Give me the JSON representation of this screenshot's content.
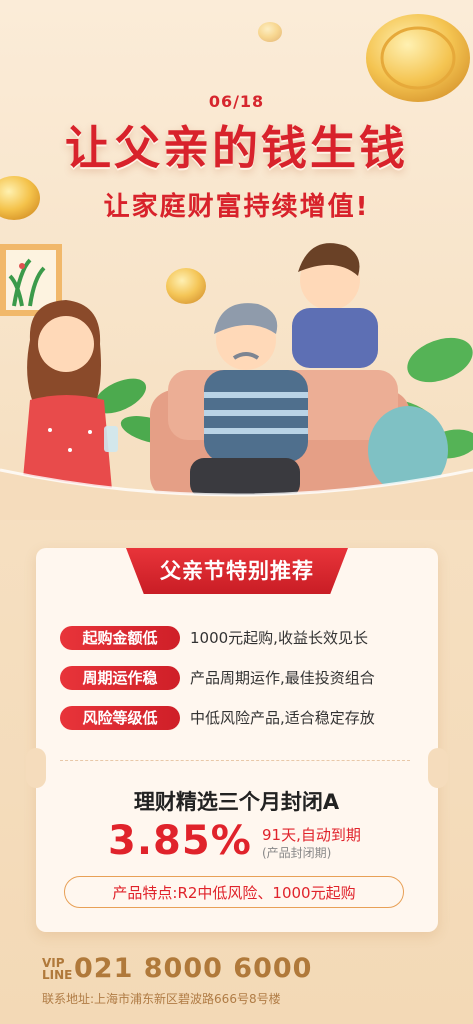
{
  "header": {
    "date": "06/18",
    "title": "让父亲的钱生钱",
    "subtitle": "让家庭财富持续增值!"
  },
  "card": {
    "ribbon_label": "父亲节特别推荐",
    "features": [
      {
        "tag": "起购金额低",
        "text": "1000元起购,收益长效见长"
      },
      {
        "tag": "周期运作稳",
        "text": "产品周期运作,最佳投资组合"
      },
      {
        "tag": "风险等级低",
        "text": "中低风险产品,适合稳定存放"
      }
    ],
    "product_name": "理财精选三个月封闭A",
    "rate": "3.85%",
    "term": "91天,自动到期",
    "term_note": "(产品封闭期)",
    "highlights": "产品特点:R2中低风险、1000元起购"
  },
  "footer": {
    "vip_line1": "VIP",
    "vip_line2": "LINE",
    "phone": "021 8000 6000",
    "address": "联系地址:上海市浦东新区碧波路666号8号楼"
  },
  "colors": {
    "brand_red": "#d8222b",
    "gold": "#b0793a",
    "background": "#f6e1c3"
  }
}
